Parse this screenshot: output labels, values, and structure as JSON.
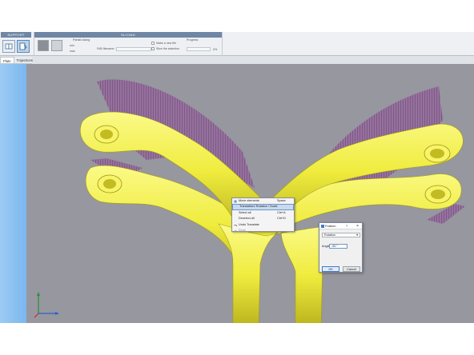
{
  "ribbon": {
    "support_title": "SUPPORT",
    "slicing_title": "SLICING",
    "partial_slicing_label": "Partial slicing",
    "min_label": "min",
    "max_label": "max",
    "fab_filename_label": "FAB filename :",
    "make_new_file_label": "Make a new file",
    "slice_selection_label": "Slice the selection",
    "progress_label": "Progress",
    "progress_percent": "0%"
  },
  "tabs": [
    "Plate",
    "Trajections"
  ],
  "context_menu": {
    "items": [
      {
        "label": "Move elements",
        "shortcut": "Space",
        "icon": "move-icon",
        "state": "normal"
      },
      {
        "label": "Translation/ Rotation / Scale",
        "shortcut": "",
        "icon": "",
        "state": "highlighted"
      },
      {
        "label": "Select all",
        "shortcut": "Ctrl+A",
        "icon": "",
        "state": "normal"
      },
      {
        "label": "Deselect all",
        "shortcut": "Ctrl+D",
        "icon": "",
        "state": "normal"
      },
      {
        "label": "Undo Translate",
        "shortcut": "",
        "icon": "undo-icon",
        "state": "normal"
      },
      {
        "label": "Redo",
        "shortcut": "",
        "icon": "redo-icon",
        "state": "disabled"
      }
    ]
  },
  "position_dialog": {
    "title": "Position",
    "help": "?",
    "close": "×",
    "mode": "Rotation",
    "angle_label": "Angle",
    "angle_value": "-90 °",
    "ok_label": "OK",
    "cancel_label": "Cancel"
  },
  "colors": {
    "viewport_bg": "#97979f",
    "part": "#f2f04a",
    "support": "#9a6fa0",
    "accent": "#3d7bd0"
  }
}
